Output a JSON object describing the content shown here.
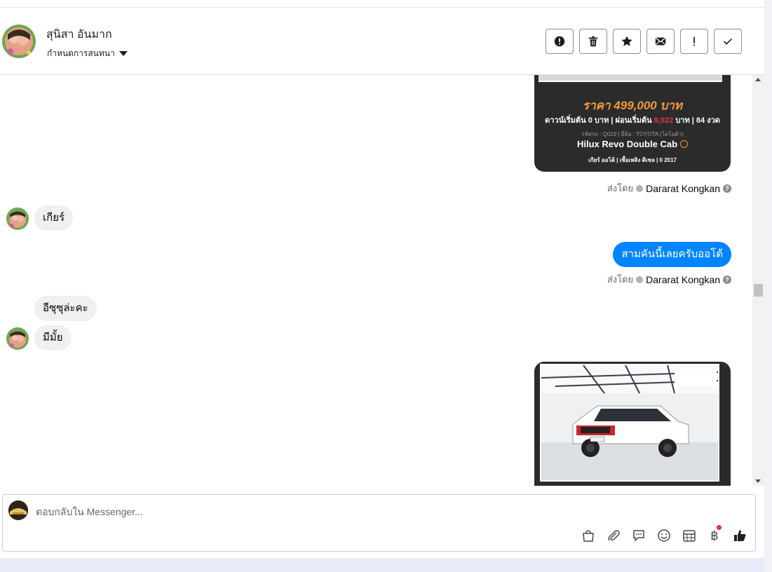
{
  "header": {
    "contact_name": "สุนิสา อันมาก",
    "conversation_settings": "กำหนดการสนทนา",
    "toolbar": [
      {
        "icon": "alert-circle-icon",
        "name": "mark-spam-button"
      },
      {
        "icon": "trash-icon",
        "name": "delete-button"
      },
      {
        "icon": "star-icon",
        "name": "star-button"
      },
      {
        "icon": "envelope-icon",
        "name": "mark-unread-button"
      },
      {
        "icon": "exclamation-icon",
        "name": "follow-up-button"
      },
      {
        "icon": "check-icon",
        "name": "mark-done-button"
      }
    ]
  },
  "messages": {
    "card1": {
      "price": "ราคา 499,000 บาท",
      "down_prefix": "ดาวน์เริ่มต้น 0 บาท | ผ่อนเริ่มต้น ",
      "down_highlight": "9,022",
      "down_suffix": " บาท | 84 งวด",
      "code": "รหัสรถ : Q019 | ยี่ห้อ : TOYOTA (โตโยต้า)",
      "model": "Hilux Revo Double Cab",
      "specs": "เกียร์ ออโต้   |   เชื้อเพลิง ดีเซล   |   0 2017"
    },
    "sent_by_label": "ส่งโดย",
    "sent_by_name": "Dararat Kongkan",
    "incoming_1": "เกียร์",
    "outgoing_1": "สามคันนี้เลยครับออโต้",
    "incoming_2": "อีซุซุล่ะคะ",
    "incoming_3": "มีมั้ย"
  },
  "composer": {
    "placeholder": "ตอบกลับใน Messenger..."
  },
  "colors": {
    "accent": "#0084ff",
    "card_bg": "#2b2b2b",
    "price_orange": "#f29a3a",
    "badge_red": "#f02849"
  }
}
